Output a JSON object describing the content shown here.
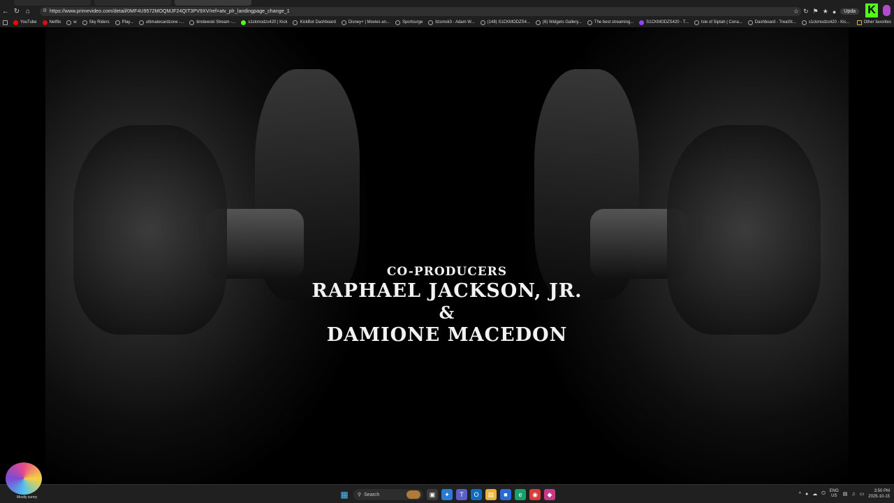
{
  "browser": {
    "url": "https://www.primevideo.com/detail/0MF4U9572MOQMJF24QIT3PV9XV/ref=atv_plr_landingpage_change_1",
    "update_label": "Upda",
    "bookmarks": [
      {
        "label": "YouTube",
        "icon": "youtube-icon",
        "color": "#ff0000"
      },
      {
        "label": "Netflix",
        "icon": "netflix-icon",
        "color": "#e50914"
      },
      {
        "label": "w",
        "icon": "globe-icon"
      },
      {
        "label": "Sky Riders",
        "icon": "globe-icon"
      },
      {
        "label": "Play...",
        "icon": "play-icon"
      },
      {
        "label": "ultimatecardzone -...",
        "icon": "globe-icon"
      },
      {
        "label": "timdewski Stream -...",
        "icon": "stream-icon"
      },
      {
        "label": "s1ckmodzs420 | Kick",
        "icon": "kick-icon",
        "color": "#53fc18"
      },
      {
        "label": "KickBot Dashboard",
        "icon": "bot-icon"
      },
      {
        "label": "Disney+ | Movies an...",
        "icon": "globe-icon"
      },
      {
        "label": "Sportsurge",
        "icon": "sport-icon"
      },
      {
        "label": "itzsmok3 - Adam W...",
        "icon": "globe-icon"
      },
      {
        "label": "(148) S1CKMODZS4...",
        "icon": "globe-icon"
      },
      {
        "label": "(6) Widgets Gallery...",
        "icon": "widgets-icon"
      },
      {
        "label": "The best streaming...",
        "icon": "globe-icon"
      },
      {
        "label": "S1CKMODZS420 - T...",
        "icon": "twitch-icon",
        "color": "#9146ff"
      },
      {
        "label": "Isle of Siptah | Cona...",
        "icon": "globe-icon"
      },
      {
        "label": "Dashboard - TreatSt...",
        "icon": "globe-icon"
      },
      {
        "label": "s1ckmodzs420 - Kic...",
        "icon": "globe-icon"
      }
    ],
    "other_favorites": "Other favorites"
  },
  "video": {
    "credit_role": "CO-PRODUCERS",
    "credit_name_1": "RAPHAEL JACKSON, JR.",
    "credit_amp": "&",
    "credit_name_2": "DAMIONE MACEDON"
  },
  "taskbar": {
    "weather_text": "Mostly sunny",
    "search_label": "Search",
    "lang_1": "ENG",
    "lang_2": "US",
    "time": "3:50 PM",
    "date": "2025-10-15"
  }
}
